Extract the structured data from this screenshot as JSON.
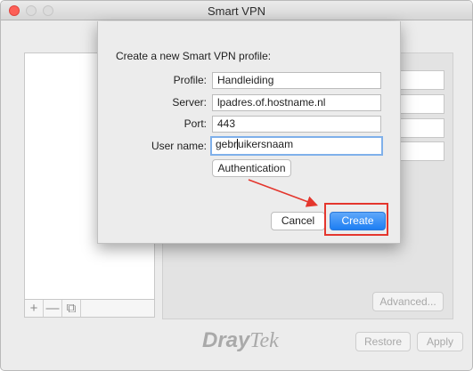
{
  "window": {
    "title": "Smart VPN"
  },
  "list_tools": {
    "add_label": "+",
    "remove_label": "—",
    "duplicate_label": "⧉"
  },
  "background": {
    "advanced_label": "Advanced...",
    "logo_part1": "Dray",
    "logo_part2": "Tek",
    "restore_label": "Restore",
    "apply_label": "Apply"
  },
  "sheet": {
    "heading": "Create a new Smart VPN profile:",
    "profile_label": "Profile:",
    "profile_value": "Handleiding",
    "server_label": "Server:",
    "server_value": "lpadres.of.hostname.nl",
    "port_label": "Port:",
    "port_value": "443",
    "username_label": "User name:",
    "username_value_before_caret": "gebr",
    "username_value_after_caret": "uikersnaam",
    "auth_label": "Authentication",
    "cancel_label": "Cancel",
    "create_label": "Create"
  },
  "colors": {
    "accent": "#1d7ef3",
    "annotation": "#e4362d",
    "focus_ring": "#7fb0ea"
  }
}
